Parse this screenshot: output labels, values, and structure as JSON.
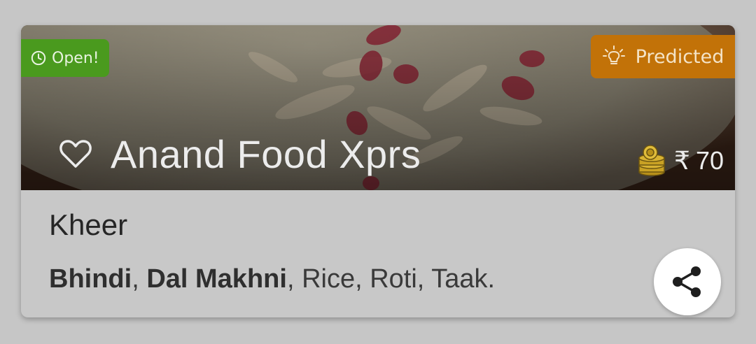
{
  "card": {
    "restaurant_name": "Anand Food Xprs",
    "status_badge": "Open!",
    "prediction_badge": "Predicted",
    "price_symbol": "₹",
    "price_value": "70",
    "dish_name": "Kheer",
    "menu_items": [
      {
        "label": "Bhindi",
        "highlight": true
      },
      {
        "label": "Dal Makhni",
        "highlight": true
      },
      {
        "label": "Rice",
        "highlight": false
      },
      {
        "label": "Roti",
        "highlight": false
      },
      {
        "label": "Taak.",
        "highlight": false
      }
    ]
  },
  "icons": {
    "favorite": "heart-outline-icon",
    "clock": "clock-icon",
    "predicted": "lightbulb-icon",
    "price": "coins-icon",
    "share": "share-icon"
  },
  "colors": {
    "open_badge": "#4a9a1e",
    "predicted_badge": "#c27208",
    "card_bg": "#c8c8c8",
    "page_bg": "#c6c6c6"
  }
}
